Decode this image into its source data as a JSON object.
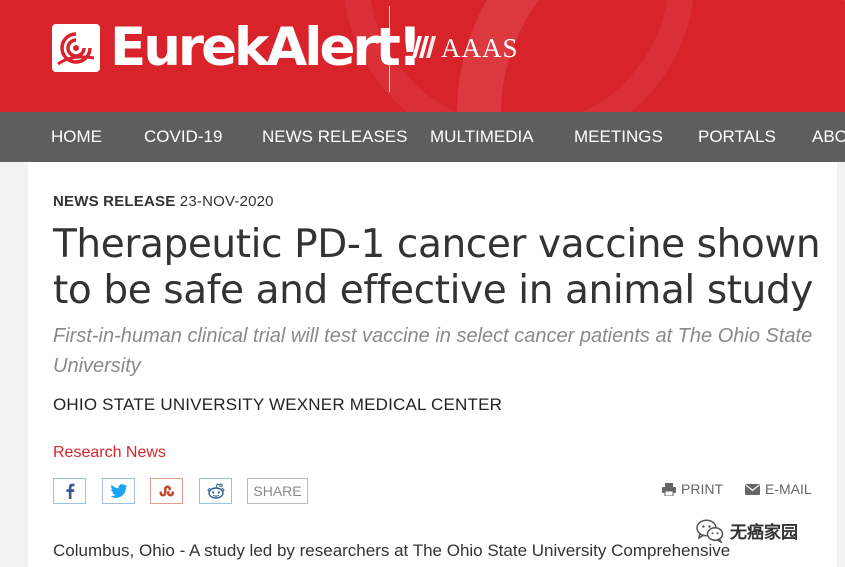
{
  "header": {
    "logo_text": "EurekAlert!",
    "partner_text": "AAAS",
    "brand_color": "#d8232a"
  },
  "nav": {
    "items": [
      {
        "label": "HOME"
      },
      {
        "label": "COVID-19"
      },
      {
        "label": "NEWS RELEASES"
      },
      {
        "label": "MULTIMEDIA"
      },
      {
        "label": "MEETINGS"
      },
      {
        "label": "PORTALS"
      },
      {
        "label": "ABOUT"
      }
    ],
    "background": "#5e5e5e"
  },
  "article": {
    "meta_label": "NEWS RELEASE",
    "meta_date": "23-NOV-2020",
    "title": "Therapeutic PD-1 cancer vaccine shown to be safe and effective in animal study",
    "subtitle": "First-in-human clinical trial will test vaccine in select cancer patients at The Ohio State University",
    "institution": "OHIO STATE UNIVERSITY WEXNER MEDICAL CENTER",
    "category": "Research News",
    "body_start": "Columbus, Ohio - A study led by researchers at The Ohio State University Comprehensive"
  },
  "share": {
    "buttons": [
      {
        "icon": "facebook-icon"
      },
      {
        "icon": "twitter-icon"
      },
      {
        "icon": "stumbleupon-icon"
      },
      {
        "icon": "reddit-icon"
      }
    ],
    "share_label": "SHARE",
    "print_label": "PRINT",
    "email_label": "E-MAIL"
  },
  "watermark": {
    "text": "无癌家园",
    "icon": "wechat-icon"
  }
}
